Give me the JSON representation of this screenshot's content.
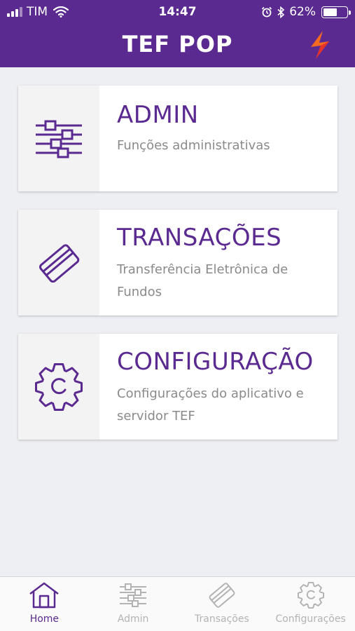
{
  "status_bar": {
    "carrier": "TIM",
    "time": "14:47",
    "battery": "62%",
    "battery_level": 0.62,
    "signal_bars": 3
  },
  "header": {
    "title": "TEF POP",
    "logo_icon": "lightning-logo-icon"
  },
  "cards": [
    {
      "title": "ADMIN",
      "description": "Funções administrativas",
      "icon": "sliders-icon"
    },
    {
      "title": "TRANSAÇÕES",
      "description": "Transferência Eletrônica de Fundos",
      "icon": "credit-card-icon"
    },
    {
      "title": "CONFIGURAÇÃO",
      "description": "Configurações do aplicativo e servidor TEF",
      "icon": "gear-icon"
    }
  ],
  "tabs": [
    {
      "label": "Home",
      "icon": "home-icon",
      "active": true
    },
    {
      "label": "Admin",
      "icon": "sliders-icon",
      "active": false
    },
    {
      "label": "Transações",
      "icon": "credit-card-icon",
      "active": false
    },
    {
      "label": "Configurações",
      "icon": "gear-icon",
      "active": false
    }
  ],
  "colors": {
    "brand_purple": "#5b2a91",
    "background": "#eeeff3",
    "inactive_tab": "#b3b3b3",
    "logo_orange": "#f36a21",
    "logo_red": "#e4312b"
  }
}
